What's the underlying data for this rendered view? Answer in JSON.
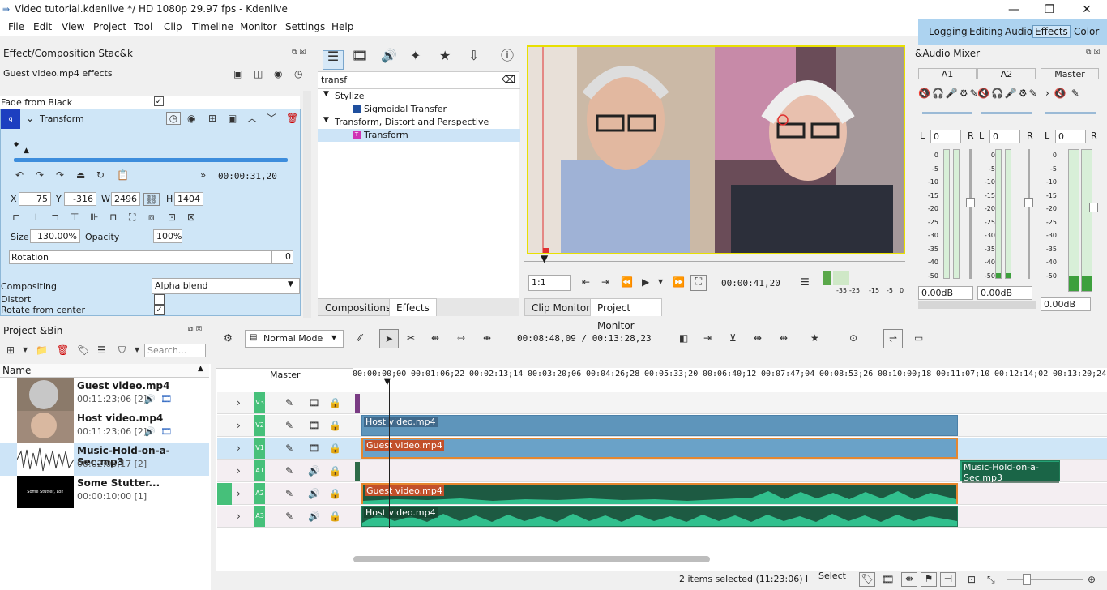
{
  "window": {
    "title": "Video tutorial.kdenlive */ HD 1080p 29.97 fps - Kdenlive",
    "minimize": "—",
    "maximize": "❐",
    "close": "✕"
  },
  "menu": [
    "File",
    "Edit",
    "View",
    "Project",
    "Tool",
    "Clip",
    "Timeline",
    "Monitor",
    "Settings",
    "Help"
  ],
  "layouts": [
    "Logging",
    "Editing",
    "Audio",
    "Effects",
    "Color"
  ],
  "effect_stack": {
    "title": "Effect/Composition Stac&k",
    "subtitle": "Guest video.mp4 effects",
    "fade": "Fade from Black",
    "transform_title": "Transform",
    "timecode": "00:00:31,20",
    "x_label": "X",
    "x": "75",
    "y_label": "Y",
    "y": "-316",
    "w_label": "W",
    "w": "2496",
    "h_label": "H",
    "h": "1404",
    "size_label": "Size",
    "size": "130.00%",
    "opacity_label": "Opacity",
    "opacity": "100%",
    "rotation_label": "Rotation",
    "rotation": "0",
    "compositing_label": "Compositing",
    "compositing": "Alpha blend",
    "distort_label": "Distort",
    "rotate_label": "Rotate from center"
  },
  "effects_panel": {
    "search": "transf",
    "cat1": "Stylize",
    "item1": "Sigmoidal Transfer",
    "cat2": "Transform, Distort and Perspective",
    "item2": "Transform",
    "tab1": "Compositions",
    "tab2": "Effects"
  },
  "monitor": {
    "zoom": "1:1",
    "timecode": "00:00:41,20",
    "meter_labels": [
      "-35",
      "-25",
      "-15",
      "-5",
      "0"
    ],
    "tab1": "Clip Monitor",
    "tab2": "Project Monitor"
  },
  "mixer": {
    "title": "&Audio Mixer",
    "ch": [
      {
        "name": "A1",
        "val": "0",
        "db": "0.00dB"
      },
      {
        "name": "A2",
        "val": "0",
        "db": "0.00dB"
      },
      {
        "name": "Master",
        "val": "0",
        "db": "0.00dB"
      }
    ],
    "L": "L",
    "R": "R",
    "scale": [
      "0",
      "-5",
      "-10",
      "-15",
      "-20",
      "-25",
      "-30",
      "-35",
      "-40",
      "-50"
    ]
  },
  "bin": {
    "title": "Project &Bin",
    "search_placeholder": "Search...",
    "col": "Name",
    "items": [
      {
        "name": "Guest video.mp4",
        "info": "00:11:23;06 [2]"
      },
      {
        "name": "Host video.mp4",
        "info": "00:11:23;06 [2]"
      },
      {
        "name": "Music-Hold-on-a-Sec.mp3",
        "info": "00:02:05;17 [2]"
      },
      {
        "name": "Some Stutter...",
        "info": "00:00:10;00 [1]",
        "thumb": "Some Stutter, Lol!"
      }
    ]
  },
  "timeline": {
    "mode": "Normal Mode",
    "timecode": "00:08:48,09 / 00:13:28,23",
    "master": "Master",
    "ruler": [
      "00:00:00;00",
      "00:01:06;22",
      "00:02:13;14",
      "00:03:20;06",
      "00:04:26;28",
      "00:05:33;20",
      "00:06:40;12",
      "00:07:47;04",
      "00:08:53;26",
      "00:10:00;18",
      "00:11:07;10",
      "00:12:14;02",
      "00:13:20;24"
    ],
    "tracks": [
      "V3",
      "V2",
      "V1",
      "A1",
      "A2",
      "A3"
    ],
    "clips": {
      "v2": "Host video.mp4",
      "v1": "Guest video.mp4",
      "a1": "Music-Hold-on-a-Sec.mp3",
      "a2": "Guest video.mp4",
      "a3": "Host video.mp4"
    }
  },
  "status": {
    "selection": "2 items selected (11:23:06) l",
    "tool": "Select"
  }
}
